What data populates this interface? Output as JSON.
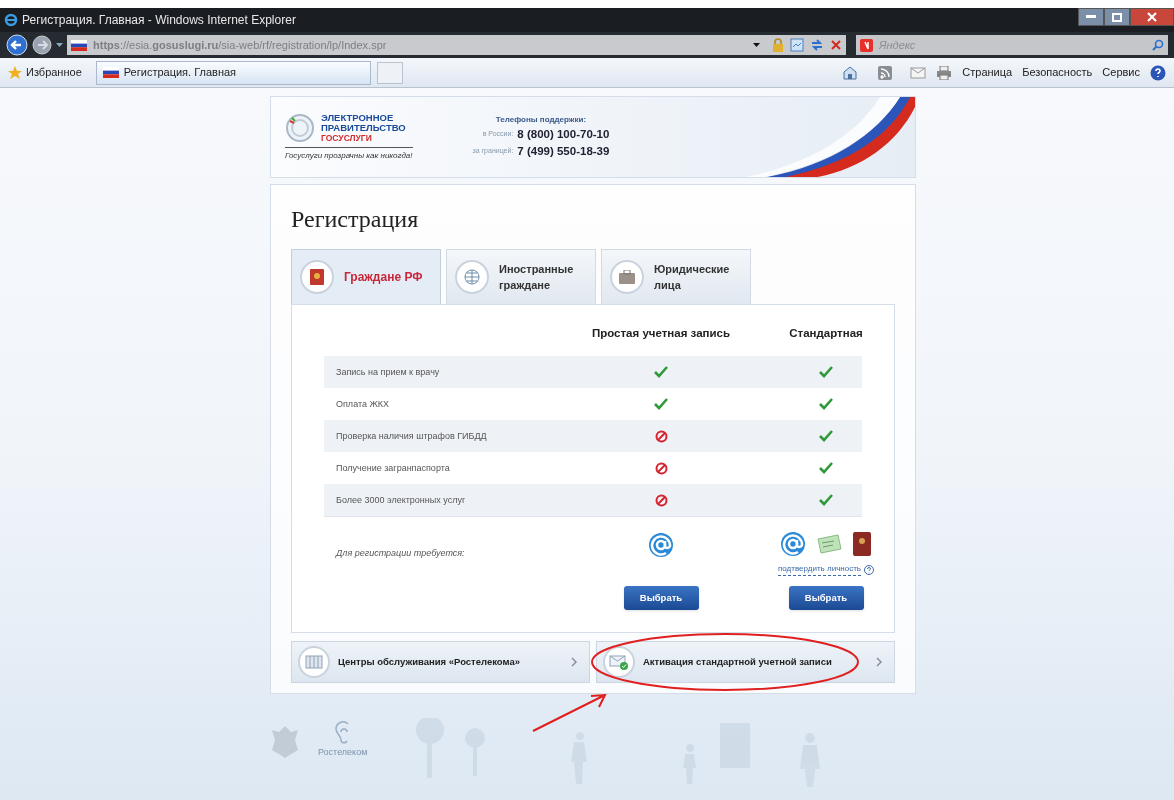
{
  "window": {
    "title": "Регистрация. Главная - Windows Internet Explorer"
  },
  "address_bar": {
    "url": "**https**://esia.**gosuslugi.ru**/sia-web/rf/registration/lp/Index.spr"
  },
  "search": {
    "placeholder": "Яндекс"
  },
  "favorites": {
    "label": "Избранное"
  },
  "browser_tab": {
    "label": "Регистрация. Главная"
  },
  "commands": [
    "Страница",
    "Безопасность",
    "Сервис"
  ],
  "header": {
    "logo_lines": [
      "ЭЛЕКТРОННОЕ",
      "ПРАВИТЕЛЬСТВО",
      "ГОСУСЛУГИ"
    ],
    "slogan": "Госуслуги прозрачны как никогда!",
    "support_title": "Телефоны поддержки:",
    "phones": [
      {
        "label": "в России:",
        "number": "8 (800) 100-70-10"
      },
      {
        "label": "за границей:",
        "number": "7 (499) 550-18-39"
      }
    ]
  },
  "page_title": "Регистрация",
  "tabs": [
    {
      "label": "Граждане РФ",
      "kind": "passport",
      "selected": true
    },
    {
      "label": "Иностранные граждане",
      "kind": "globe",
      "selected": false
    },
    {
      "label": "Юридические лица",
      "kind": "briefcase",
      "selected": false
    }
  ],
  "table": {
    "columns": [
      "Простая учетная запись",
      "Стандартная"
    ],
    "rows": [
      {
        "feature": "Запись на прием к врачу",
        "simple": true,
        "standard": true
      },
      {
        "feature": "Оплата ЖКХ",
        "simple": true,
        "standard": true
      },
      {
        "feature": "Проверка наличия штрафов ГИБДД",
        "simple": false,
        "standard": true
      },
      {
        "feature": "Получение загранпаспорта",
        "simple": false,
        "standard": true
      },
      {
        "feature": "Более 3000 электронных услуг",
        "simple": false,
        "standard": true
      }
    ],
    "requirements_label": "Для регистрации требуется:",
    "requirements": [
      {
        "icons": [
          {
            "kind": "email"
          }
        ]
      },
      {
        "icons": [
          {
            "kind": "email"
          },
          {
            "kind": "snils"
          },
          {
            "kind": "passport"
          }
        ]
      }
    ],
    "confirm_link": "подтвердить личность",
    "buttons": [
      "Выбрать",
      "Выбрать"
    ]
  },
  "links": [
    {
      "label": "Центры обслуживания «Ростелекома»",
      "kind": "building",
      "highlighted": false
    },
    {
      "label": "Активация стандартной учетной записи",
      "kind": "envelope",
      "highlighted": true
    }
  ],
  "footer": {
    "logo_label": "Ростелеком"
  }
}
